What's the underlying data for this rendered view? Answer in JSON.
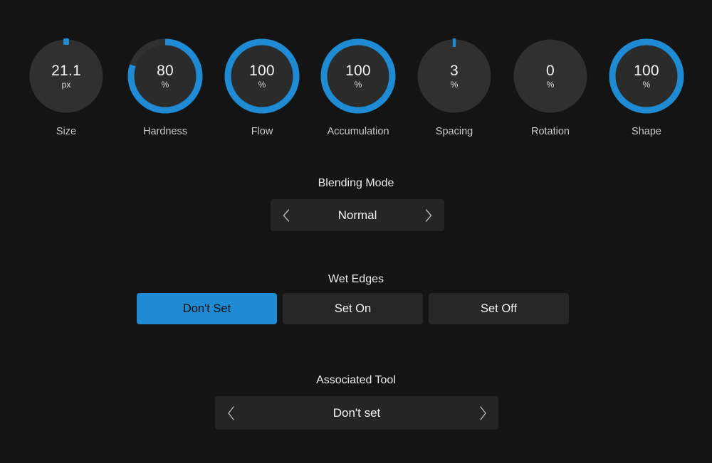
{
  "theme": {
    "background": "#141414",
    "accent": "#1e8bd4",
    "knob_track": "#303030",
    "knob_face": "#2b2b2b",
    "control_bg": "#252525",
    "text": "#f2f2f2"
  },
  "knobs": [
    {
      "label": "Size",
      "value": "21.1",
      "unit": "px",
      "percent": 0,
      "indicator": "square",
      "ring": false
    },
    {
      "label": "Hardness",
      "value": "80",
      "unit": "%",
      "percent": 80,
      "indicator": "none",
      "ring": true
    },
    {
      "label": "Flow",
      "value": "100",
      "unit": "%",
      "percent": 100,
      "indicator": "none",
      "ring": true
    },
    {
      "label": "Accumulation",
      "value": "100",
      "unit": "%",
      "percent": 100,
      "indicator": "none",
      "ring": true
    },
    {
      "label": "Spacing",
      "value": "3",
      "unit": "%",
      "percent": 3,
      "indicator": "tick",
      "ring": false
    },
    {
      "label": "Rotation",
      "value": "0",
      "unit": "%",
      "percent": 0,
      "indicator": "none",
      "ring": false
    },
    {
      "label": "Shape",
      "value": "100",
      "unit": "%",
      "percent": 100,
      "indicator": "none",
      "ring": true
    }
  ],
  "blending_mode": {
    "title": "Blending Mode",
    "value": "Normal",
    "prev_icon": "chevron-left-icon",
    "next_icon": "chevron-right-icon"
  },
  "wet_edges": {
    "title": "Wet Edges",
    "options": [
      {
        "label": "Don't Set",
        "active": true
      },
      {
        "label": "Set On",
        "active": false
      },
      {
        "label": "Set Off",
        "active": false
      }
    ]
  },
  "associated_tool": {
    "title": "Associated Tool",
    "value": "Don't set",
    "prev_icon": "chevron-left-icon",
    "next_icon": "chevron-right-icon"
  }
}
